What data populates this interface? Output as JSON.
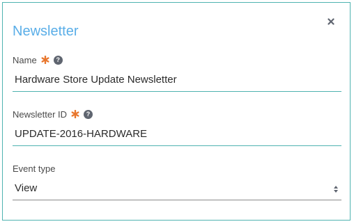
{
  "dialog": {
    "title": "Newsletter",
    "close_icon": "close-icon"
  },
  "fields": {
    "name": {
      "label": "Name",
      "required": true,
      "value": "Hardware Store Update Newsletter"
    },
    "newsletter_id": {
      "label": "Newsletter ID",
      "required": true,
      "value": "UPDATE-2016-HARDWARE"
    },
    "event_type": {
      "label": "Event type",
      "selected": "View"
    }
  },
  "colors": {
    "title": "#5aaee8",
    "accent": "#4fb3b0",
    "required": "#e8772e",
    "help": "#5f6570"
  },
  "help_glyph": "?"
}
